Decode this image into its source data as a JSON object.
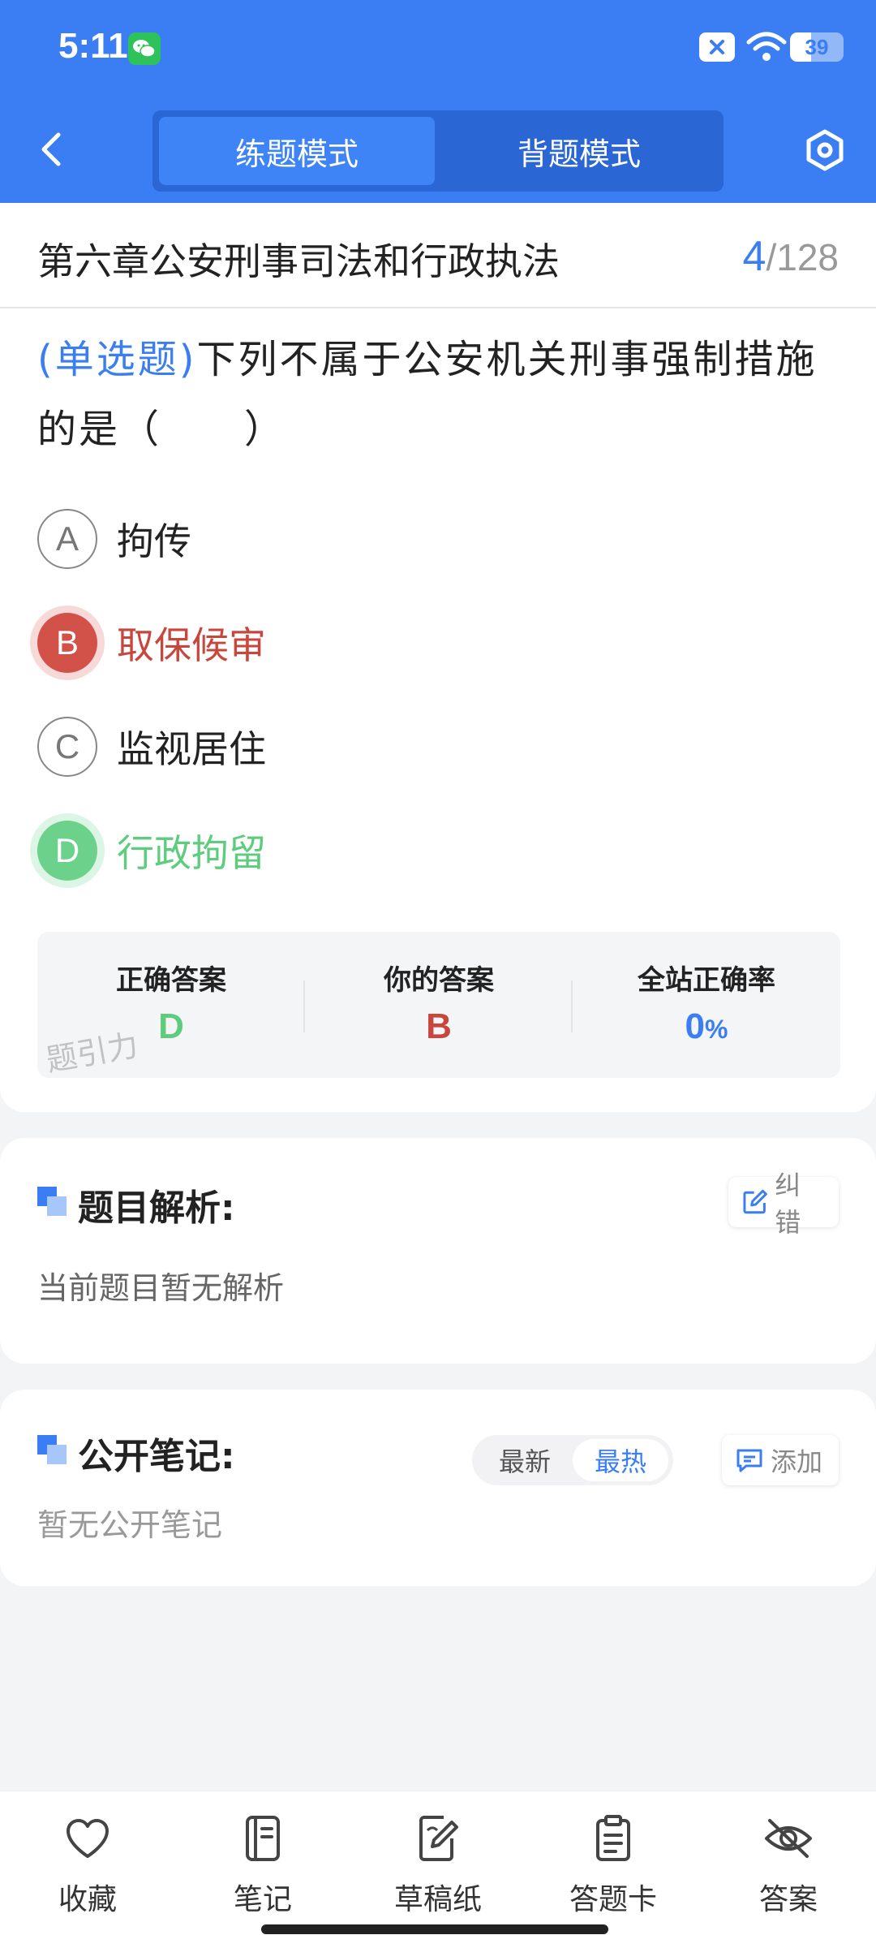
{
  "status_bar": {
    "time": "5:11",
    "battery": "39"
  },
  "header": {
    "tabs": [
      {
        "label": "练题模式",
        "active": true
      },
      {
        "label": "背题模式",
        "active": false
      }
    ]
  },
  "question": {
    "chapter": "第六章公安刑事司法和行政执法",
    "current": "4",
    "total": "/128",
    "type": "(单选题)",
    "text": "下列不属于公安机关刑事强制措施的是（　　）",
    "options": [
      {
        "letter": "A",
        "text": "拘传",
        "state": "normal"
      },
      {
        "letter": "B",
        "text": "取保候审",
        "state": "wrong"
      },
      {
        "letter": "C",
        "text": "监视居住",
        "state": "normal"
      },
      {
        "letter": "D",
        "text": "行政拘留",
        "state": "right"
      }
    ]
  },
  "answer_summary": {
    "correct_label": "正确答案",
    "correct_value": "D",
    "yours_label": "你的答案",
    "yours_value": "B",
    "rate_label": "全站正确率",
    "rate_value": "0",
    "rate_unit": "%",
    "watermark": "题引力"
  },
  "analysis": {
    "title": "题目解析:",
    "report_btn": "纠错",
    "content": "当前题目暂无解析"
  },
  "notes": {
    "title": "公开笔记:",
    "sort_options": [
      "最新",
      "最热"
    ],
    "add_btn": "添加",
    "empty": "暂无公开笔记"
  },
  "bottom_bar": {
    "items": [
      {
        "label": "收藏",
        "icon": "heart-icon"
      },
      {
        "label": "笔记",
        "icon": "notebook-icon"
      },
      {
        "label": "草稿纸",
        "icon": "draft-icon"
      },
      {
        "label": "答题卡",
        "icon": "clipboard-icon"
      },
      {
        "label": "答案",
        "icon": "eye-off-icon"
      }
    ]
  },
  "colors": {
    "primary": "#3b7ef3",
    "wrong": "#d2524a",
    "right": "#6cd28b"
  }
}
